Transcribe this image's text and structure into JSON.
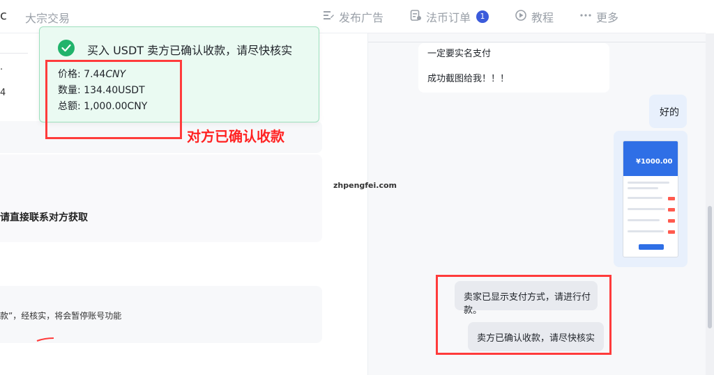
{
  "topbar": {
    "cut_left": "c",
    "nav": [
      {
        "label": "大宗交易"
      },
      {
        "label": "发布广告",
        "icon": "post-ad-icon"
      },
      {
        "label": "法币订单",
        "icon": "order-icon",
        "badge": "1"
      },
      {
        "label": "教程",
        "icon": "play-icon"
      },
      {
        "label": "更多",
        "icon": "more-dots-icon"
      }
    ]
  },
  "left": {
    "fragment_1": "·",
    "fragment_2": "4",
    "card_title": "请直接联系对方获取",
    "card_text": "款”，经核实，将会暂停账号功能"
  },
  "toast": {
    "icon": "check-circle-icon",
    "title": "买入 USDT 卖方已确认收款，请尽快核实",
    "price_label": "价格: ",
    "price_value": "7.44",
    "price_unit": "CNY",
    "quantity_label": "数量: ",
    "quantity_value": "134.40USDT",
    "total_label": "总额: ",
    "total_value": "1,000.00CNY"
  },
  "annotation": {
    "text": "对方已确认收款",
    "color": "#ff2222"
  },
  "watermark": "zhpengfei.com",
  "chat": {
    "messages": [
      {
        "line1": "一定要实名支付",
        "line2": "成功截图给我！！！"
      },
      {
        "text": "好的"
      },
      {
        "image_amount": "¥1000.00"
      },
      {
        "text": "卖家已显示支付方式，请进行付款。"
      },
      {
        "text": "卖方已确认收款，请尽快核实"
      }
    ]
  },
  "colors": {
    "accent": "#3b5bdb",
    "success": "#21b36b",
    "toast_bg": "#eafaf2",
    "annotation_red": "#ff3b3b"
  }
}
